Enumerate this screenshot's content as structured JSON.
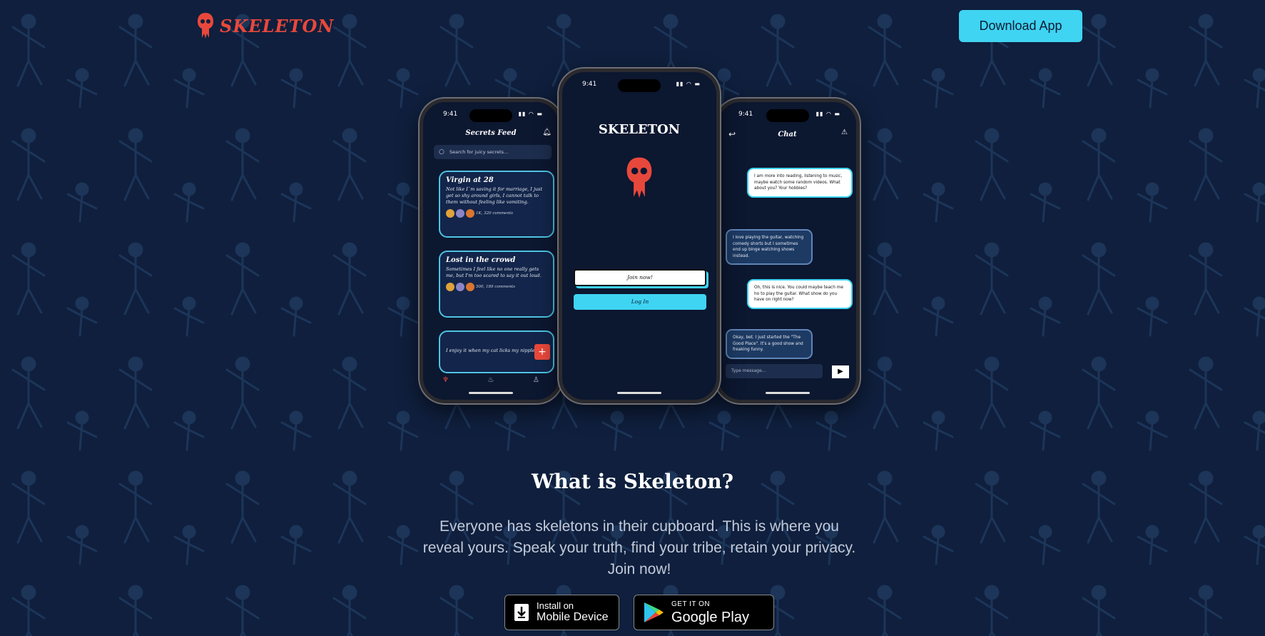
{
  "brand": {
    "name": "SKELETON",
    "accent": "#e8483b",
    "cyan": "#3fd4f2",
    "background": "#0f1f3d"
  },
  "header": {
    "download_label": "Download App"
  },
  "phone_left": {
    "time": "9:41",
    "title": "Secrets Feed",
    "search_placeholder": "Search for juicy secrets...",
    "cards": [
      {
        "title": "Virgin at 28",
        "body": "Not like I`m saving it for marriage, I just get so shy around girls, I cannot talk to them without feeling like vomiting.",
        "meta": "1K, 320 comments"
      },
      {
        "title": "Lost in the crowd",
        "body": "Sometimes I feel like no one really gets me, but I'm too scared to say it out loud.",
        "meta": "500, 189 comments"
      },
      {
        "title": "",
        "body": "I enjoy it when my cat licks my nipples",
        "meta": ""
      }
    ],
    "fab": "+"
  },
  "phone_mid": {
    "time": "9:41",
    "logo": "SKELETON",
    "join_label": "Join now!",
    "login_label": "Log In"
  },
  "phone_right": {
    "time": "9:41",
    "title": "Chat",
    "messages": [
      {
        "from": "me",
        "text": "I am more into reading, listening to music, maybe watch some random videos. What about you? Your hobbies?"
      },
      {
        "from": "them",
        "text": "I love playing the guitar, watching comedy shorts but I sometimes end up binge watching shows instead."
      },
      {
        "from": "me",
        "text": "Oh, this is nice. You could maybe teach me ho to play the guitar. What show do you have on right now?"
      },
      {
        "from": "them",
        "text": "Okay, bet. I just started the \"The Good Place\". It's a good show and freaking funny."
      }
    ],
    "input_placeholder": "Type message..."
  },
  "about": {
    "title": "What is Skeleton?",
    "body": "Everyone has skeletons in their cupboard. This is where you reveal yours. Speak your truth, find your tribe, retain your privacy. Join now!"
  },
  "stores": {
    "mobile": {
      "line1": "Install on",
      "line2": "Mobile Device"
    },
    "google": {
      "line1": "GET IT ON",
      "line2": "Google Play"
    }
  }
}
